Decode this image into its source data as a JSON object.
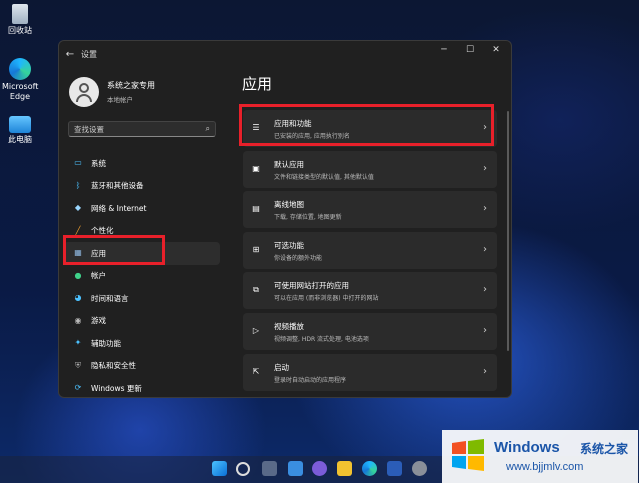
{
  "desktop": {
    "icons": [
      {
        "label": "回收站"
      },
      {
        "label": "Microsoft Edge"
      },
      {
        "label": "此电脑"
      }
    ]
  },
  "window": {
    "title": "设置",
    "back": "←",
    "minimize": "─",
    "maximize": "☐",
    "close": "✕"
  },
  "profile": {
    "name": "系统之家专用",
    "account": "本地帐户"
  },
  "search": {
    "placeholder": "查找设置"
  },
  "sidebar": {
    "items": [
      {
        "label": "系统",
        "icon": "monitor-icon"
      },
      {
        "label": "蓝牙和其他设备",
        "icon": "bluetooth-icon"
      },
      {
        "label": "网络 & Internet",
        "icon": "wifi-icon"
      },
      {
        "label": "个性化",
        "icon": "brush-icon"
      },
      {
        "label": "应用",
        "icon": "apps-icon",
        "selected": true
      },
      {
        "label": "帐户",
        "icon": "person-icon"
      },
      {
        "label": "时间和语言",
        "icon": "globe-clock-icon"
      },
      {
        "label": "游戏",
        "icon": "gamepad-icon"
      },
      {
        "label": "辅助功能",
        "icon": "accessibility-icon"
      },
      {
        "label": "隐私和安全性",
        "icon": "shield-icon"
      },
      {
        "label": "Windows 更新",
        "icon": "update-icon"
      }
    ]
  },
  "main": {
    "title": "应用",
    "cards": [
      {
        "title": "应用和功能",
        "desc": "已安装的应用, 应用执行别名",
        "icon": "apps-list-icon"
      },
      {
        "title": "默认应用",
        "desc": "文件和链接类型的默认值, 其他默认值",
        "icon": "default-apps-icon"
      },
      {
        "title": "离线地图",
        "desc": "下载, 存储位置, 地图更新",
        "icon": "map-icon"
      },
      {
        "title": "可选功能",
        "desc": "你设备的额外功能",
        "icon": "optional-features-icon"
      },
      {
        "title": "可使用网站打开的应用",
        "desc": "可以在应用 (而非浏览器) 中打开的网站",
        "icon": "web-apps-icon"
      },
      {
        "title": "视频播放",
        "desc": "视频调整, HDR 流式处理, 电池选项",
        "icon": "video-icon"
      },
      {
        "title": "启动",
        "desc": "登录时自动启动的应用程序",
        "icon": "startup-icon"
      }
    ]
  },
  "watermark": {
    "brand": "Windows",
    "cn": "系统之家",
    "url": "www.bjjmlv.com"
  },
  "colors": {
    "highlight": "#e8202a",
    "accent": "#4cc2ff",
    "panel": "#202020",
    "card": "#2b2b2b"
  }
}
